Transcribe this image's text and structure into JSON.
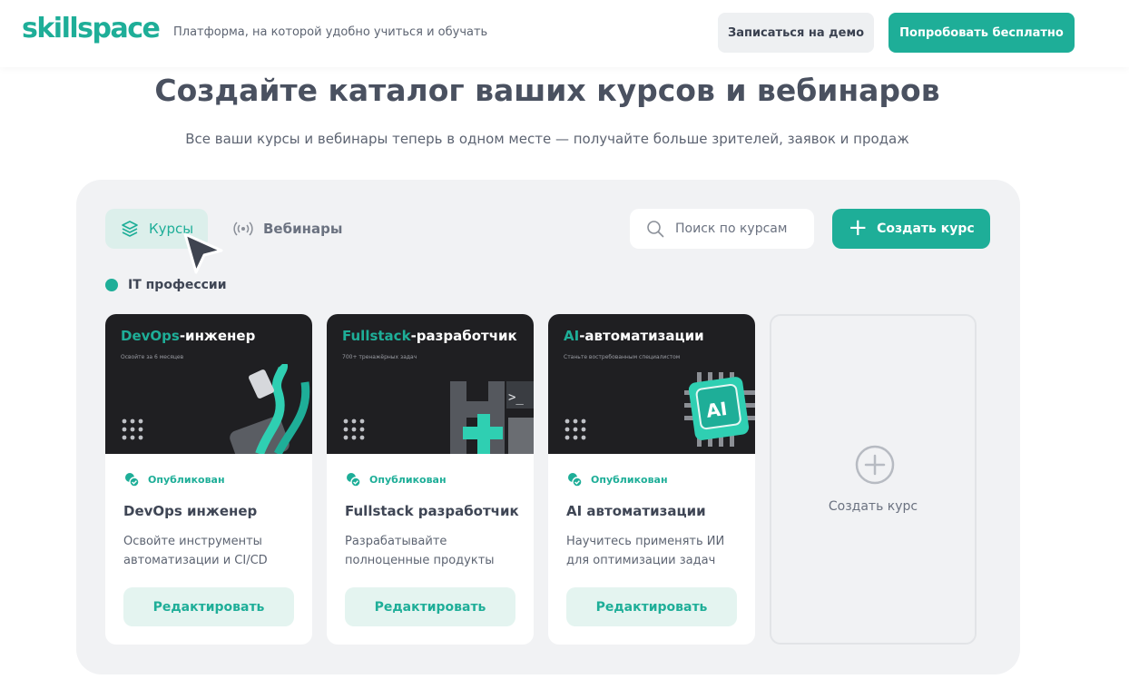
{
  "header": {
    "logo": "skillspace",
    "tagline": "Платформа, на которой удобно учиться и обучать",
    "demo_button": "Записаться на демо",
    "try_button": "Попробовать бесплатно"
  },
  "hero": {
    "title": "Создайте каталог ваших курсов и вебинаров",
    "subtitle": "Все ваши курсы и вебинары теперь в одном месте — получайте больше зрителей, заявок и продаж"
  },
  "toolbar": {
    "tabs": [
      {
        "label": "Курсы",
        "active": true,
        "icon": "layers-icon"
      },
      {
        "label": "Вебинары",
        "active": false,
        "icon": "broadcast-icon"
      }
    ],
    "search_placeholder": "Поиск по курсам",
    "create_button": "Создать курс"
  },
  "category": "IT профессии",
  "courses": [
    {
      "image_title_accent": "DevOps",
      "image_title_rest": "-инженер",
      "image_subtitle": "Освойте за 6 месяцев",
      "status": "Опубликован",
      "title": "DevOps инженер",
      "description": "Освойте инструменты автоматизации и CI/CD",
      "edit_button": "Редактировать"
    },
    {
      "image_title_accent": "Fullstack",
      "image_title_rest": "-разработчик",
      "image_subtitle": "700+ тренажёрных задач",
      "status": "Опубликован",
      "title": "Fullstack разработчик",
      "description": "Разрабатывайте полноценные продукты",
      "edit_button": "Редактировать"
    },
    {
      "image_title_accent": "AI",
      "image_title_rest": "-автоматизации",
      "image_subtitle": "Станьте востребованным специалистом",
      "status": "Опубликован",
      "title": "AI автоматизации",
      "description": "Научитесь применять ИИ для оптимизации задач",
      "edit_button": "Редактировать"
    }
  ],
  "new_course_card": {
    "label": "Создать курс"
  },
  "colors": {
    "accent": "#1eae98",
    "panel": "#f1f2f4",
    "card_image_bg": "#1f1f22"
  }
}
